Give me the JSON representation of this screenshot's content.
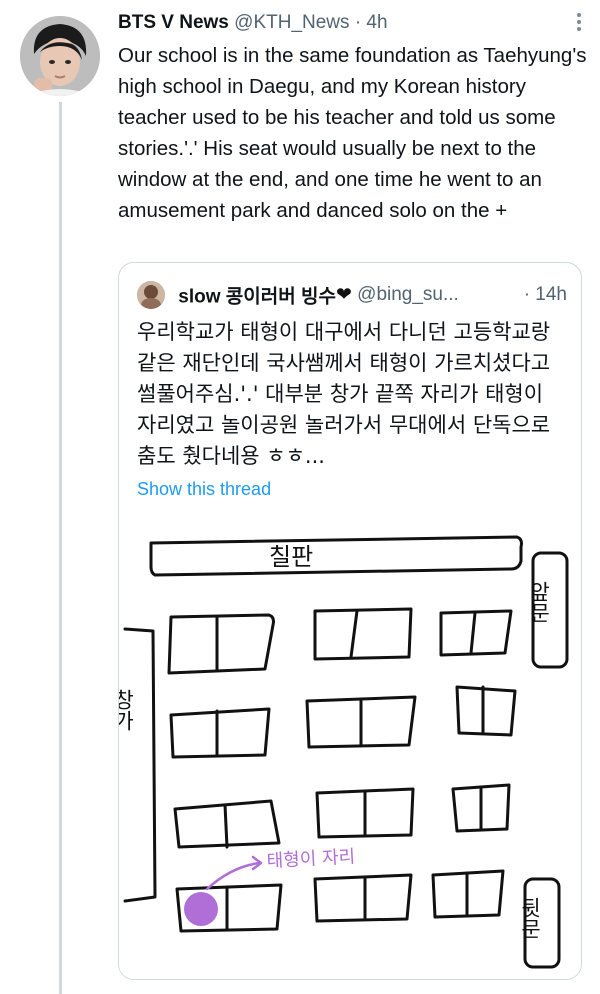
{
  "tweet": {
    "display_name": "BTS V News",
    "handle": "@KTH_News",
    "separator": "·",
    "time": "4h",
    "text": "Our school is in the same foundation as Taehyung's high school in Daegu, and my Korean history teacher used to be his teacher and told us some stories.'.' His seat would usually be next to the window at the end, and one time he went to an amusement park and danced solo on the +"
  },
  "quoted": {
    "display_name": "slow 콩이러버 빙수",
    "heart": "❤",
    "handle": "@bing_su...",
    "separator": "·",
    "time": "14h",
    "text": "우리학교가 태형이 대구에서 다니던 고등학교랑 같은 재단인데 국사쌤께서 태형이 가르치셨다고 썰풀어주심.'.' 대부분 창가 끝쪽 자리가 태형이 자리였고 놀이공원 놀러가서 무대에서 단독으로 춤도 췄다네용 ㅎㅎ...",
    "show_thread": "Show this thread"
  },
  "drawing": {
    "blackboard": "칠판",
    "front_door": "앞문",
    "back_door": "뒷문",
    "window": "창가",
    "seat_label": "태형이 자리",
    "ink_color": "#111111",
    "highlight_color": "#b06fd6"
  },
  "colors": {
    "link": "#1d9bf0",
    "secondary_text": "#536471",
    "border": "#cfd9de"
  }
}
